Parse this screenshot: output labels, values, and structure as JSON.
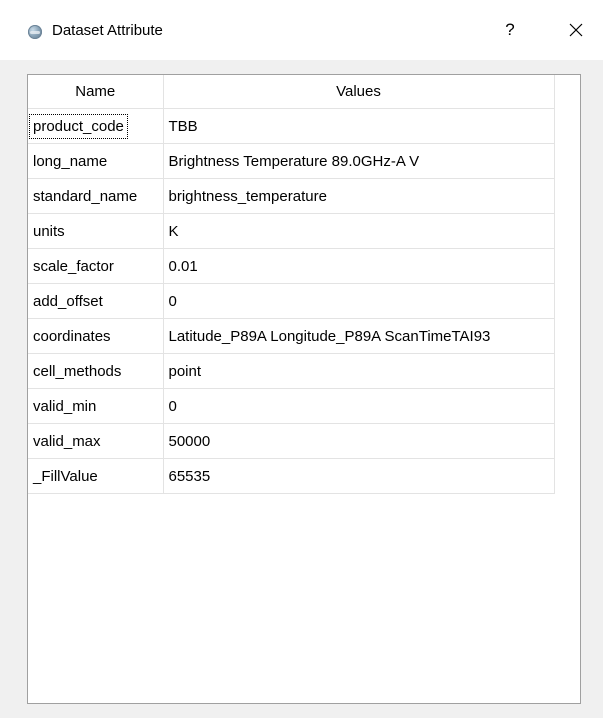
{
  "window": {
    "title": "Dataset Attribute",
    "help_label": "?",
    "close_label": "close"
  },
  "table": {
    "columns": [
      "Name",
      "Values"
    ],
    "rows": [
      {
        "name": "product_code",
        "value": "TBB"
      },
      {
        "name": "long_name",
        "value": "Brightness Temperature 89.0GHz-A V"
      },
      {
        "name": "standard_name",
        "value": "brightness_temperature"
      },
      {
        "name": "units",
        "value": "K"
      },
      {
        "name": "scale_factor",
        "value": "0.01"
      },
      {
        "name": "add_offset",
        "value": "0"
      },
      {
        "name": "coordinates",
        "value": "Latitude_P89A Longitude_P89A ScanTimeTAI93"
      },
      {
        "name": "cell_methods",
        "value": "point"
      },
      {
        "name": "valid_min",
        "value": "0"
      },
      {
        "name": "valid_max",
        "value": "50000"
      },
      {
        "name": "_FillValue",
        "value": "65535"
      }
    ],
    "focused_row": 0
  }
}
